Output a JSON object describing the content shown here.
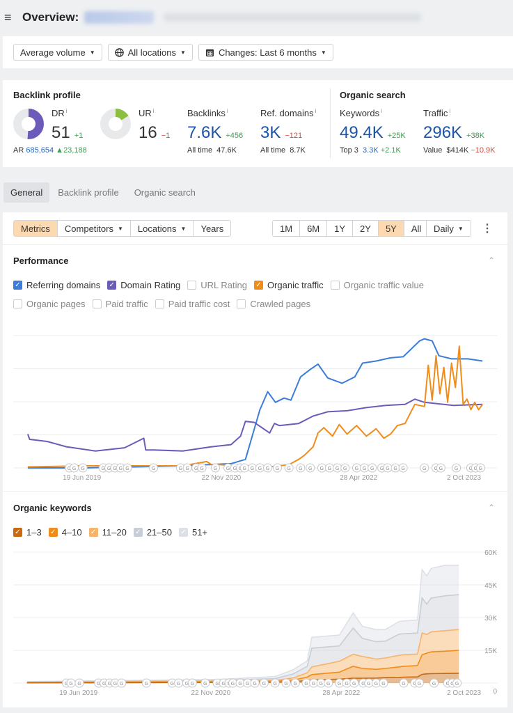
{
  "header": {
    "menu_icon": "hamburger-icon",
    "title": "Overview:"
  },
  "filters": {
    "volume": "Average volume",
    "locations": "All locations",
    "changes": "Changes: Last 6 months"
  },
  "backlink_profile": {
    "title": "Backlink profile",
    "dr": {
      "label": "DR",
      "value": "51",
      "delta": "+1",
      "fill_fraction": 0.51
    },
    "ur": {
      "label": "UR",
      "value": "16",
      "delta": "−1",
      "fill_fraction": 0.16
    },
    "ar": {
      "label": "AR",
      "value": "685,654",
      "delta": "23,188"
    },
    "backlinks": {
      "label": "Backlinks",
      "value": "7.6K",
      "delta": "+456",
      "sub_label": "All time",
      "sub_value": "47.6K"
    },
    "ref_domains": {
      "label": "Ref. domains",
      "value": "3K",
      "delta": "−121",
      "sub_label": "All time",
      "sub_value": "8.7K"
    },
    "info_glyph": "i"
  },
  "organic_search": {
    "title": "Organic search",
    "keywords": {
      "label": "Keywords",
      "value": "49.4K",
      "delta": "+25K",
      "sub_label": "Top 3",
      "sub_value": "3.3K",
      "sub_delta": "+2.1K"
    },
    "traffic": {
      "label": "Traffic",
      "value": "296K",
      "delta": "+38K",
      "sub_label": "Value",
      "sub_value": "$414K",
      "sub_delta": "−10.9K"
    }
  },
  "tabs": [
    {
      "label": "General",
      "active": true
    },
    {
      "label": "Backlink profile",
      "active": false
    },
    {
      "label": "Organic search",
      "active": false
    }
  ],
  "toolbar": {
    "left": [
      {
        "label": "Metrics",
        "active": true,
        "dropdown": false
      },
      {
        "label": "Competitors",
        "active": false,
        "dropdown": true
      },
      {
        "label": "Locations",
        "active": false,
        "dropdown": true
      },
      {
        "label": "Years",
        "active": false,
        "dropdown": false
      }
    ],
    "ranges": [
      {
        "label": "1M",
        "active": false
      },
      {
        "label": "6M",
        "active": false
      },
      {
        "label": "1Y",
        "active": false
      },
      {
        "label": "2Y",
        "active": false
      },
      {
        "label": "5Y",
        "active": true
      },
      {
        "label": "All",
        "active": false
      }
    ],
    "granularity": "Daily",
    "more_icon": "⋮"
  },
  "performance": {
    "title": "Performance",
    "collapse_icon": "^",
    "checkboxes_row1": [
      {
        "label": "Referring domains",
        "checked": true,
        "color": "#3b7dd8"
      },
      {
        "label": "Domain Rating",
        "checked": true,
        "color": "#6c5bb8"
      },
      {
        "label": "URL Rating",
        "checked": false,
        "color": "#c8cbd0"
      },
      {
        "label": "Organic traffic",
        "checked": true,
        "color": "#f08c1a"
      },
      {
        "label": "Organic traffic value",
        "checked": false,
        "color": "#c8cbd0"
      }
    ],
    "checkboxes_row2": [
      {
        "label": "Organic pages",
        "checked": false,
        "color": "#c8cbd0"
      },
      {
        "label": "Paid traffic",
        "checked": false,
        "color": "#c8cbd0"
      },
      {
        "label": "Paid traffic cost",
        "checked": false,
        "color": "#c8cbd0"
      },
      {
        "label": "Crawled pages",
        "checked": false,
        "color": "#c8cbd0"
      }
    ]
  },
  "organic_keywords": {
    "title": "Organic keywords",
    "collapse_icon": "^",
    "checkboxes": [
      {
        "label": "1–3",
        "checked": true,
        "color": "#c76a12"
      },
      {
        "label": "4–10",
        "checked": true,
        "color": "#f08c1a"
      },
      {
        "label": "11–20",
        "checked": true,
        "color": "#f7b36b"
      },
      {
        "label": "21–50",
        "checked": true,
        "color": "#c9ced6"
      },
      {
        "label": "51+",
        "checked": true,
        "color": "#dde1e7"
      }
    ]
  },
  "chart_data": [
    {
      "type": "line",
      "title": "Performance",
      "x_ticks": [
        "19 Jun 2019",
        "22 Nov 2020",
        "28 Apr 2022",
        "2 Oct 2023"
      ],
      "x_range": [
        2018.75,
        2023.75
      ],
      "y_axis_labels": "hidden",
      "grid": true,
      "gridlines": 5,
      "annotation_marker": "G",
      "annotation_positions": [
        2019.33,
        2019.38,
        2019.47,
        2019.68,
        2019.74,
        2019.8,
        2019.86,
        2019.93,
        2020.2,
        2020.48,
        2020.55,
        2020.64,
        2020.7,
        2020.84,
        2020.97,
        2021.04,
        2021.1,
        2021.14,
        2021.22,
        2021.3,
        2021.38,
        2021.48,
        2021.6,
        2021.72,
        2021.82,
        2021.94,
        2022.02,
        2022.1,
        2022.18,
        2022.3,
        2022.38,
        2022.46,
        2022.56,
        2022.62,
        2022.7,
        2022.78,
        2023.0,
        2023.12,
        2023.17,
        2023.33,
        2023.48,
        2023.53,
        2023.58
      ],
      "series": [
        {
          "name": "Referring domains",
          "color": "#3b7dd8",
          "x": [
            2018.9,
            2019.5,
            2020.0,
            2020.5,
            2021.0,
            2021.15,
            2021.3,
            2021.38,
            2021.46,
            2021.55,
            2021.62,
            2021.72,
            2021.82,
            2021.9,
            2022.0,
            2022.15,
            2022.28,
            2022.36,
            2022.5,
            2022.65,
            2022.78,
            2022.95,
            2023.0,
            2023.08,
            2023.15,
            2023.28,
            2023.45,
            2023.6
          ],
          "y": [
            0.0,
            0.0,
            0.01,
            0.02,
            0.04,
            0.08,
            0.55,
            0.72,
            0.62,
            0.66,
            0.64,
            0.86,
            0.93,
            0.98,
            0.85,
            0.8,
            0.86,
            0.99,
            1.01,
            1.04,
            1.05,
            1.2,
            1.22,
            1.2,
            1.06,
            1.03,
            1.03,
            1.01
          ]
        },
        {
          "name": "Domain Rating",
          "color": "#6c5bb8",
          "x": [
            2018.9,
            2018.92,
            2019.1,
            2019.3,
            2019.6,
            2019.9,
            2020.1,
            2020.12,
            2020.2,
            2020.5,
            2020.8,
            2021.0,
            2021.1,
            2021.15,
            2021.24,
            2021.4,
            2021.45,
            2021.5,
            2021.7,
            2021.85,
            2022.0,
            2022.2,
            2022.4,
            2022.6,
            2022.8,
            2022.9,
            2023.0,
            2023.3,
            2023.6
          ],
          "y": [
            0.32,
            0.27,
            0.25,
            0.2,
            0.16,
            0.19,
            0.28,
            0.17,
            0.17,
            0.16,
            0.2,
            0.22,
            0.3,
            0.44,
            0.43,
            0.33,
            0.42,
            0.4,
            0.42,
            0.49,
            0.53,
            0.54,
            0.57,
            0.59,
            0.6,
            0.65,
            0.62,
            0.59,
            0.6
          ]
        },
        {
          "name": "Organic traffic",
          "color": "#f08c1a",
          "x": [
            2018.9,
            2019.5,
            2020.0,
            2020.5,
            2020.75,
            2020.8,
            2020.9,
            2021.0,
            2021.2,
            2021.4,
            2021.6,
            2021.7,
            2021.76,
            2021.85,
            2021.9,
            2021.96,
            2022.05,
            2022.12,
            2022.2,
            2022.3,
            2022.4,
            2022.5,
            2022.58,
            2022.65,
            2022.72,
            2022.8,
            2022.9,
            2023.0,
            2023.04,
            2023.08,
            2023.12,
            2023.16,
            2023.2,
            2023.24,
            2023.28,
            2023.32,
            2023.36,
            2023.4,
            2023.44,
            2023.48,
            2023.52,
            2023.56,
            2023.6
          ],
          "y": [
            0.01,
            0.02,
            0.02,
            0.02,
            0.06,
            0.03,
            0.03,
            0.02,
            0.02,
            0.01,
            0.03,
            0.08,
            0.12,
            0.2,
            0.33,
            0.38,
            0.3,
            0.41,
            0.32,
            0.4,
            0.3,
            0.37,
            0.28,
            0.32,
            0.4,
            0.42,
            0.6,
            0.58,
            0.97,
            0.64,
            1.06,
            0.7,
            0.95,
            0.62,
            0.99,
            0.76,
            1.15,
            0.6,
            0.65,
            0.55,
            0.62,
            0.55,
            0.6
          ]
        }
      ]
    },
    {
      "type": "area",
      "title": "Organic keywords",
      "x_ticks": [
        "19 Jun 2019",
        "22 Nov 2020",
        "28 Apr 2022",
        "2 Oct 2023"
      ],
      "x_range": [
        2018.75,
        2023.75
      ],
      "y_ticks": [
        "0",
        "15K",
        "30K",
        "45K",
        "60K"
      ],
      "ylim": [
        0,
        60000
      ],
      "grid": true,
      "stacked": true,
      "annotation_marker": "G",
      "x": [
        2018.9,
        2020.0,
        2021.0,
        2021.6,
        2021.8,
        2021.95,
        2022.0,
        2022.3,
        2022.45,
        2022.55,
        2022.7,
        2022.8,
        2022.95,
        2023.0,
        2023.15,
        2023.2,
        2023.25,
        2023.3,
        2023.45,
        2023.6
      ],
      "series": [
        {
          "name": "1–3",
          "color": "#c76a12",
          "values": [
            100,
            200,
            300,
            400,
            600,
            1200,
            1400,
            1800,
            2200,
            2200,
            2300,
            2500,
            2600,
            2700,
            2800,
            4000,
            4200,
            4300,
            4400,
            4500
          ]
        },
        {
          "name": "4–10",
          "color": "#f08c1a",
          "values": [
            100,
            200,
            300,
            400,
            800,
            1500,
            2500,
            3200,
            5500,
            4500,
            4000,
            4200,
            4800,
            5000,
            5200,
            9000,
            9500,
            10000,
            10200,
            10500
          ]
        },
        {
          "name": "11–20",
          "color": "#f7b36b",
          "values": [
            100,
            200,
            300,
            400,
            1000,
            2000,
            3500,
            5000,
            5500,
            5500,
            4700,
            4800,
            5300,
            5300,
            5300,
            10000,
            8500,
            9200,
            9400,
            9500
          ]
        },
        {
          "name": "21–50",
          "color": "#c9ced6",
          "values": [
            200,
            300,
            400,
            800,
            1800,
            3000,
            8600,
            7000,
            12000,
            8300,
            8000,
            7700,
            9700,
            9600,
            9600,
            16000,
            14000,
            15500,
            16000,
            16000
          ]
        },
        {
          "name": "51+",
          "color": "#dde1e7",
          "values": [
            200,
            300,
            400,
            1000,
            2000,
            2500,
            5000,
            5000,
            7000,
            5500,
            5500,
            5300,
            5800,
            5900,
            6000,
            13000,
            13000,
            13500,
            14000,
            13500
          ]
        }
      ]
    }
  ]
}
